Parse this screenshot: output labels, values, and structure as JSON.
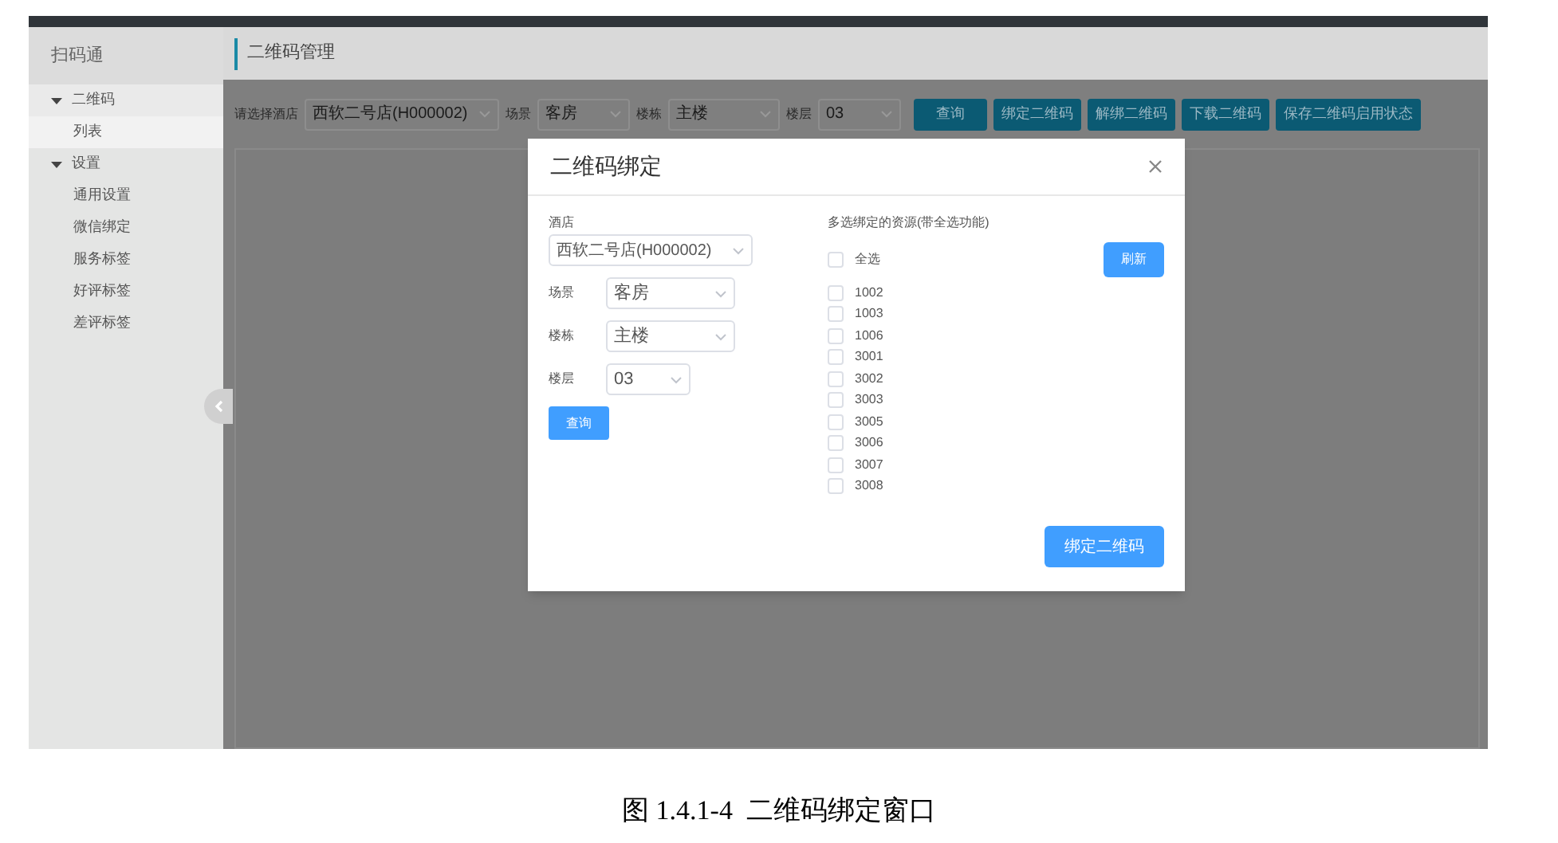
{
  "sidebar": {
    "title": "扫码通",
    "items": [
      {
        "label": "二维码",
        "expanded": true,
        "children": [
          {
            "label": "列表",
            "selected": true
          }
        ]
      },
      {
        "label": "设置",
        "expanded": true,
        "children": [
          {
            "label": "通用设置",
            "selected": false
          },
          {
            "label": "微信绑定",
            "selected": false
          },
          {
            "label": "服务标签",
            "selected": false
          },
          {
            "label": "好评标签",
            "selected": false
          },
          {
            "label": "差评标签",
            "selected": false
          }
        ]
      }
    ]
  },
  "header": {
    "title": "二维码管理"
  },
  "toolbar": {
    "fields": [
      {
        "label": "请选择酒店",
        "value": "西软二号店(H000002)"
      },
      {
        "label": "场景",
        "value": "客房"
      },
      {
        "label": "楼栋",
        "value": "主楼"
      },
      {
        "label": "楼层",
        "value": "03"
      }
    ],
    "buttons": [
      "查询",
      "绑定二维码",
      "解绑二维码",
      "下载二维码",
      "保存二维码启用状态"
    ]
  },
  "dialog": {
    "title": "二维码绑定",
    "fields": [
      {
        "kind": "stacked",
        "label": "酒店",
        "value": "西软二号店(H000002)"
      },
      {
        "kind": "inline",
        "label": "场景",
        "value": "客房"
      },
      {
        "kind": "inline",
        "label": "楼栋",
        "value": "主楼"
      },
      {
        "kind": "inline",
        "label": "楼层",
        "value": "03"
      }
    ],
    "query_button": "查询",
    "resources": {
      "label": "多选绑定的资源(带全选功能)",
      "select_all": {
        "label": "全选",
        "checked": false
      },
      "refresh_button": "刷新",
      "items": [
        {
          "label": "1002",
          "checked": false
        },
        {
          "label": "1003",
          "checked": false
        },
        {
          "label": "1006",
          "checked": false
        },
        {
          "label": "3001",
          "checked": false
        },
        {
          "label": "3002",
          "checked": false
        },
        {
          "label": "3003",
          "checked": false
        },
        {
          "label": "3005",
          "checked": false
        },
        {
          "label": "3006",
          "checked": false
        },
        {
          "label": "3007",
          "checked": false
        },
        {
          "label": "3008",
          "checked": false
        }
      ]
    },
    "bind_button": "绑定二维码"
  },
  "caption": "图 1.4.1-4  二维码绑定窗口"
}
